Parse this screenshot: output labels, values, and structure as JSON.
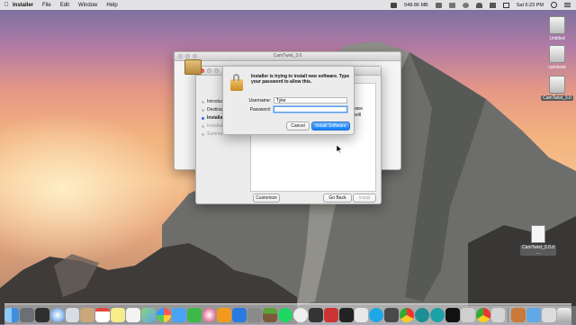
{
  "menubar": {
    "app_name": "Installer",
    "menus": [
      "File",
      "Edit",
      "Window",
      "Help"
    ],
    "status": {
      "disk": "548.86 MB",
      "clock": "Sat 6:23 PM"
    }
  },
  "desktop_icons": [
    {
      "label": "Untitled"
    },
    {
      "label": "camtwist"
    },
    {
      "label": "CamTwist_3.0"
    },
    {
      "label": "CamTwist_3.0.d ..."
    }
  ],
  "installer_window": {
    "title": "CamTwist_3.0",
    "steps": [
      "Introduc",
      "Destinati",
      "Installati",
      "Installati",
      "Summa"
    ],
    "body_fragments": [
      "software",
      "or will"
    ],
    "customize_label": "Customize",
    "go_back_label": "Go Back",
    "install_label": "Install"
  },
  "auth_dialog": {
    "message": "Installer is trying to install new software. Type your password to allow this.",
    "username_label": "Username:",
    "username_value": "Tyler",
    "password_label": "Password:",
    "password_value": "",
    "cancel_label": "Cancel",
    "install_label": "Install Software"
  },
  "colors": {
    "accent": "#0d81ff",
    "close_red": "#fc605c"
  },
  "dock_icons": [
    "finder-icon",
    "launchpad-icon",
    "safari-icon",
    "mail-icon",
    "contacts-icon",
    "calendar-icon",
    "notes-icon",
    "reminders-icon",
    "maps-icon",
    "photos-icon",
    "messages-icon",
    "facetime-icon",
    "itunes-icon",
    "ibooks-icon",
    "app-store-icon",
    "system-preferences-icon",
    "minecraft-icon",
    "spotify-icon",
    "vlc-icon",
    "app-icon",
    "terminal-icon",
    "skype-icon",
    "arduino-icon",
    "trash-icon"
  ]
}
